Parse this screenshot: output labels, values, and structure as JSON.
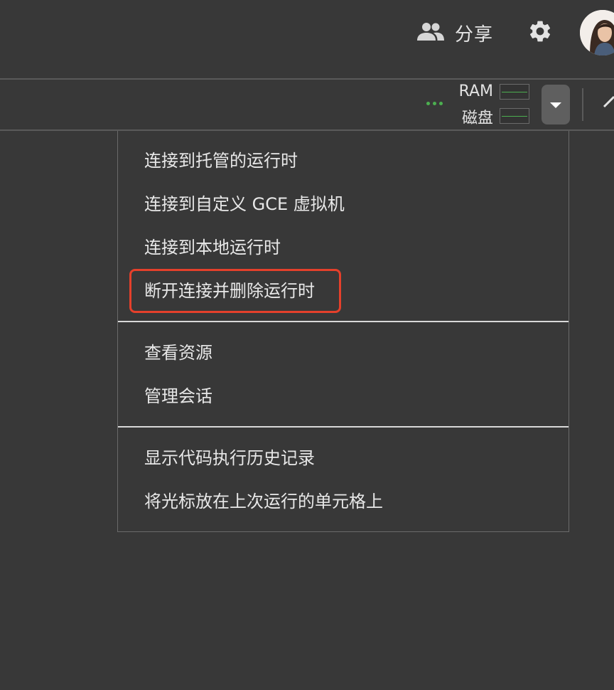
{
  "header": {
    "share_label": "分享",
    "share_icon": "people-icon",
    "settings_icon": "gear-icon",
    "avatar": "user-avatar"
  },
  "toolbar": {
    "status_icon": "connected-dots-icon",
    "ram_label": "RAM",
    "disk_label": "磁盘",
    "dropdown_icon": "caret-down-icon",
    "edit_icon": "expand-icon",
    "status_color": "#4caf50"
  },
  "menu": {
    "group1": [
      "连接到托管的运行时",
      "连接到自定义 GCE 虚拟机",
      "连接到本地运行时",
      "断开连接并删除运行时"
    ],
    "group2": [
      "查看资源",
      "管理会话"
    ],
    "group3": [
      "显示代码执行历史记录",
      "将光标放在上次运行的单元格上"
    ],
    "highlight_color": "#e5402b"
  }
}
